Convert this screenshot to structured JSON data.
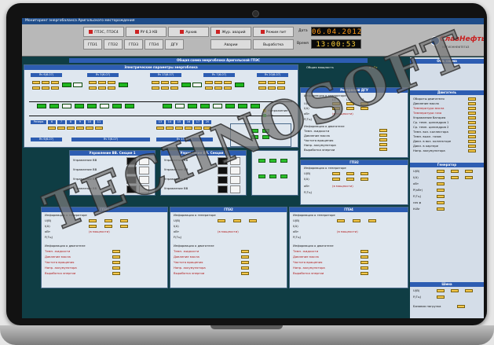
{
  "window": {
    "title": "Мониторинг энергобаланса Аригольского месторождения"
  },
  "toolbar": {
    "buttons_row1": [
      "ГПЭС, ГПЭС4",
      "РУ 6,3 КВ",
      "Архив",
      "Жур. аварий",
      "Режим пит"
    ],
    "buttons_row2": [
      "ГПЭ1",
      "ГПЭ2",
      "ГПЭ3",
      "ГПЭ4",
      "ДГУ",
      "Аварии",
      "Выработка"
    ],
    "date_label": "Дата",
    "date_value": "06.04.2012",
    "time_label": "Время",
    "time_value": "13:00:53"
  },
  "logo": {
    "text": "СлавНефть",
    "sub": "МЕГИОННЕФТЕГАЗ"
  },
  "main": {
    "title": "Общая схема энергоблока Аригольской ГПЭС",
    "elec_header": "Электрические параметры энергоблока",
    "power_label": "Общая мощность",
    "power_value": "0 кВт",
    "units_top": [
      "Яч 6(6-07)",
      "Яч 5(6-07)",
      "Яч 13(6-07)",
      "Яч 7(6-07)",
      "Яч 20(6-07)"
    ],
    "reserve_row": [
      "Резерв",
      "6",
      "7",
      "8",
      "9",
      "10",
      "11"
    ],
    "reserve_row2": [
      "13",
      "14",
      "15",
      "16",
      "17",
      "20"
    ],
    "legend": [
      "Напряжение",
      "Ток"
    ],
    "control_header": "Управление ВВ. Секция 1",
    "control_header2": "Управление ВВ. Секция 2",
    "control_rows": [
      "Управление ВВ",
      "Управление ВВ",
      "Управление ВВ",
      "Управление ВВ"
    ],
    "dgu_header": "Резервный ДГУ",
    "gen_info": "Информация о генераторе",
    "engine_info": "Информация о двигателе",
    "l_cols": [
      "L1",
      "L2",
      "L3"
    ],
    "gen_rows": [
      "U(В)",
      "I(А)",
      "кВт",
      "P(кВт)",
      "F(Гц)"
    ],
    "eng_rows": [
      "Темп. жидкости",
      "Давление масла",
      "Частота вращения",
      "Напр. аккумулятора",
      "Выработка энергии"
    ],
    "gpeg_headers": [
      "ГПЭ1",
      "ГПЭ2",
      "ГПЭ3",
      "ГПЭ4"
    ],
    "red_text": "(в мощности)"
  },
  "sidebar": {
    "h1": "Обр. схема",
    "h2": "Двигатель",
    "h3": "Генератор",
    "h4": "Шина",
    "engine_rows": [
      "Обороты двигателя",
      "Давление масла",
      "Температура масла",
      "Температура газа",
      "Управление батарея",
      "Ср. темп. цилиндров 1",
      "Ср. темп. цилиндров 2",
      "Темп. воз. коллектора",
      "Темп. выхл. газов",
      "Давл. в воз. коллекторе",
      "Давл. в картере",
      "Напр. аккумулятора"
    ],
    "gen_rows": [
      "U(В)",
      "I(А)",
      "кВт",
      "P(кВт)",
      "F(Гц)",
      "cos φ",
      "kVAr"
    ],
    "bus_rows": [
      "U(В)",
      "F(Гц)",
      "Базовая нагрузка"
    ]
  },
  "watermark": {
    "text": "TECHNOSOFT"
  },
  "colors": {
    "accent": "#2d5db2",
    "screen_bg": "#0f3d44",
    "lcd_orange": "#ff9a1a",
    "lcd_yellow": "#ffd23a",
    "brand_red": "#c81e1e"
  }
}
